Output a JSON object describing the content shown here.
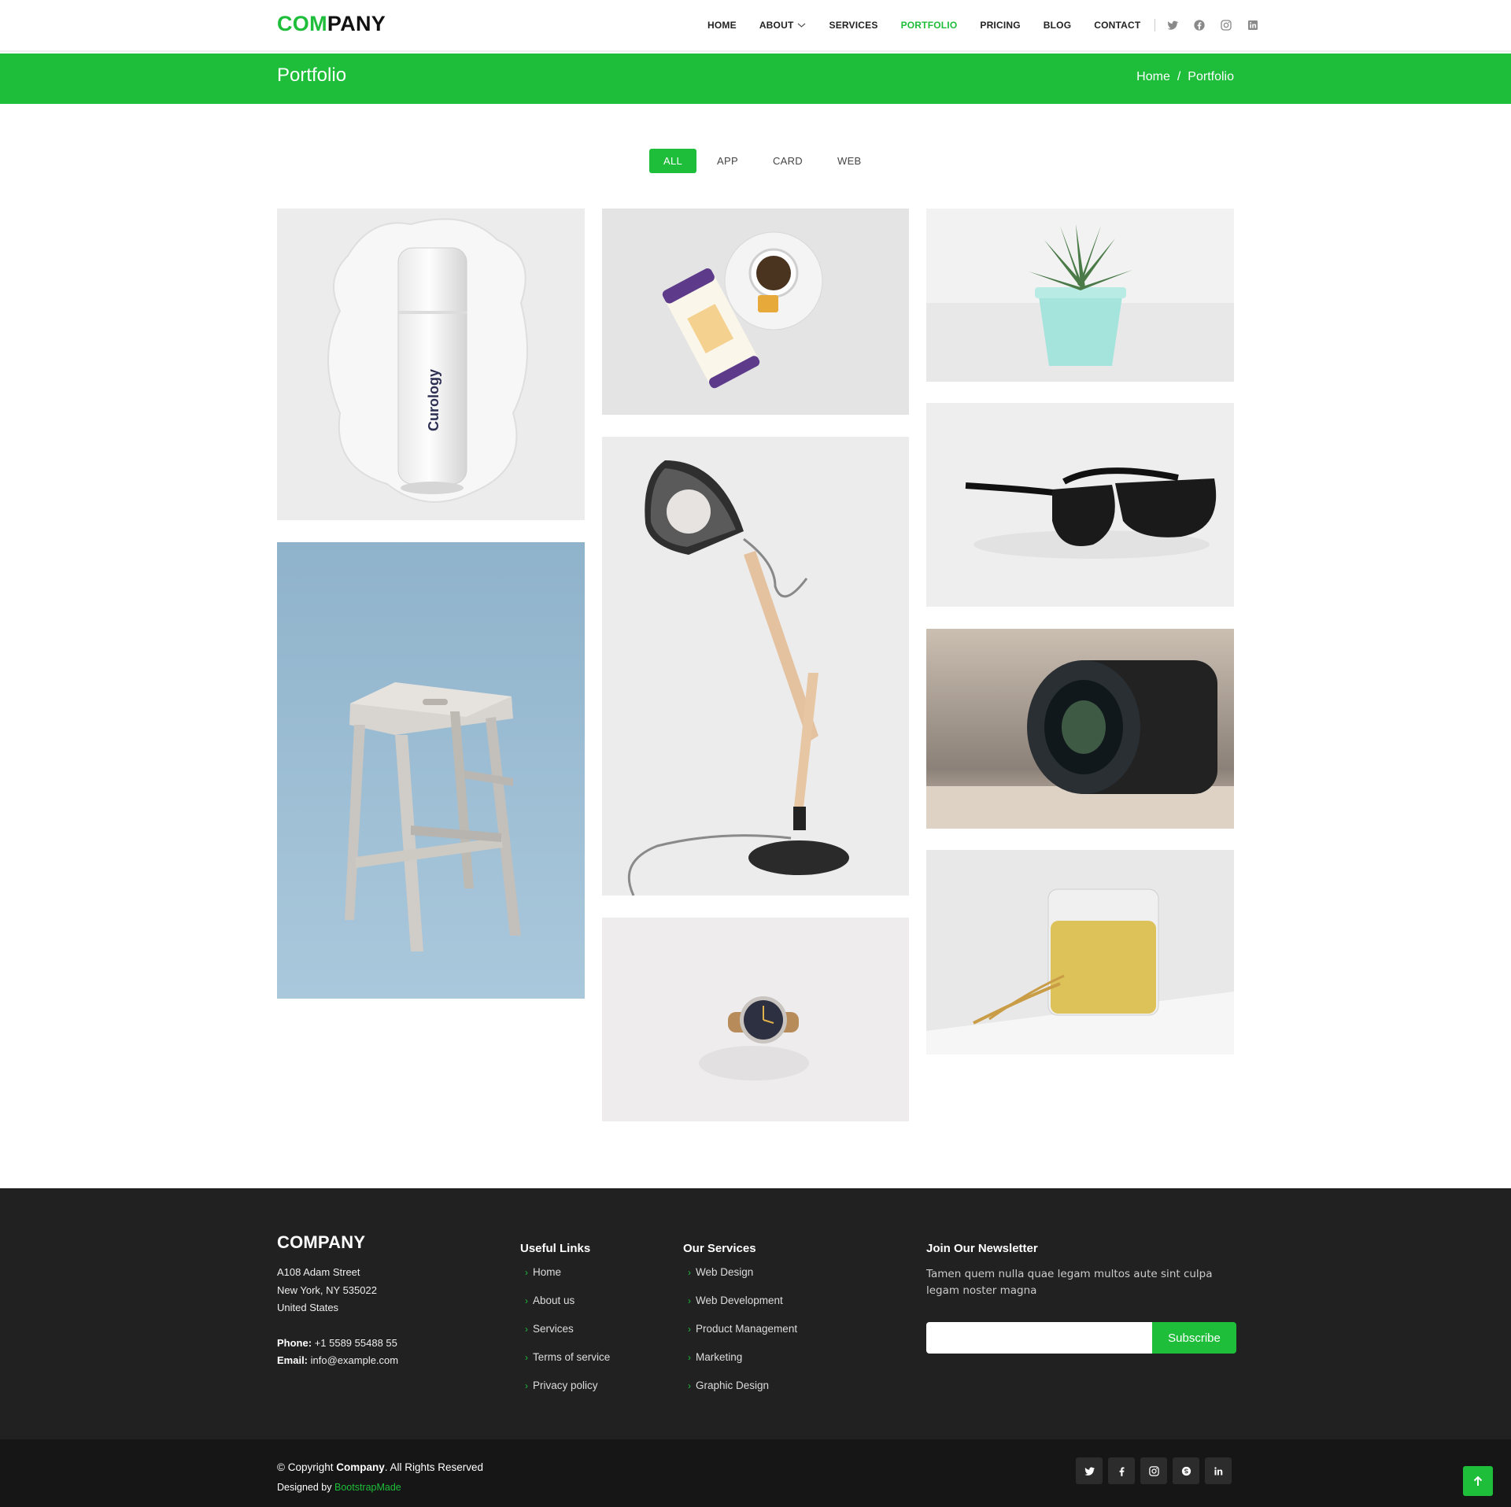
{
  "brand": {
    "accent_part": "COM",
    "rest_part": "PANY",
    "accent_color": "#1ebd3a"
  },
  "nav": {
    "items": [
      {
        "label": "HOME"
      },
      {
        "label": "ABOUT"
      },
      {
        "label": "SERVICES"
      },
      {
        "label": "PORTFOLIO"
      },
      {
        "label": "PRICING"
      },
      {
        "label": "BLOG"
      },
      {
        "label": "CONTACT"
      }
    ],
    "active": "PORTFOLIO",
    "social_icons": [
      "twitter-icon",
      "facebook-icon",
      "instagram-icon",
      "linkedin-icon"
    ]
  },
  "breadcrumb": {
    "title": "Portfolio",
    "trail": [
      "Home",
      "Portfolio"
    ],
    "separator": "/"
  },
  "filters": {
    "items": [
      "ALL",
      "APP",
      "CARD",
      "WEB"
    ],
    "active": "ALL"
  },
  "portfolio": {
    "items": [
      {
        "subject": "white bottle with Curology label",
        "label_text": "Curology"
      },
      {
        "subject": "stool on blue background"
      },
      {
        "subject": "tea cup and honeycomb packet"
      },
      {
        "subject": "desk lamp"
      },
      {
        "subject": "wrist watch"
      },
      {
        "subject": "potted succulent"
      },
      {
        "subject": "black sunglasses"
      },
      {
        "subject": "camera lens"
      },
      {
        "subject": "glass of tea with wheat"
      }
    ]
  },
  "footer": {
    "company": "COMPANY",
    "address": [
      "A108 Adam Street",
      "New York, NY 535022",
      "United States"
    ],
    "phone_label": "Phone:",
    "phone": "+1 5589 55488 55",
    "email_label": "Email:",
    "email": "info@example.com",
    "useful_links": {
      "title": "Useful Links",
      "items": [
        "Home",
        "About us",
        "Services",
        "Terms of service",
        "Privacy policy"
      ]
    },
    "services": {
      "title": "Our Services",
      "items": [
        "Web Design",
        "Web Development",
        "Product Management",
        "Marketing",
        "Graphic Design"
      ]
    },
    "newsletter": {
      "title": "Join Our Newsletter",
      "text": "Tamen quem nulla quae legam multos aute sint culpa legam noster magna",
      "input_value": "",
      "button": "Subscribe"
    },
    "copyright_prefix": "© Copyright",
    "copyright_brand": "Company",
    "copyright_suffix": ". All Rights Reserved",
    "designed_prefix": "Designed by",
    "designed_link": "BootstrapMade",
    "social_icons": [
      "twitter-icon",
      "facebook-icon",
      "instagram-icon",
      "skype-icon",
      "linkedin-icon"
    ]
  }
}
